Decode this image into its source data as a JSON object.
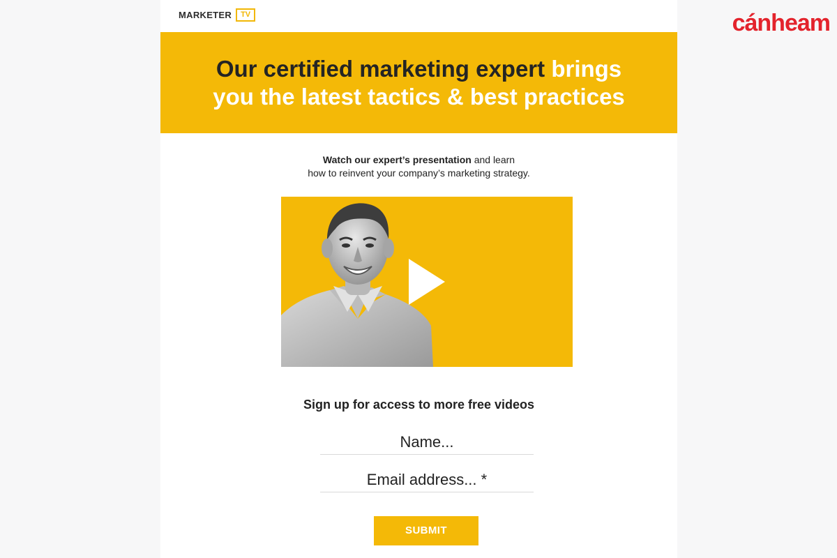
{
  "brand": {
    "name": "cánheam",
    "color": "#e3232c"
  },
  "header": {
    "logo_word": "MARKETER",
    "logo_badge": "TV",
    "accent_color": "#f4b907"
  },
  "hero": {
    "line1_dark": "Our certified marketing expert",
    "line1_light": "brings",
    "line2_light": "you the latest tactics & best practices"
  },
  "intro": {
    "bold": "Watch our expert’s presentation",
    "rest": "and learn",
    "line2": "how to reinvent your company’s marketing strategy."
  },
  "video": {
    "play_icon": "play-icon"
  },
  "signup": {
    "title": "Sign up for access to more free videos",
    "name_placeholder": "Name...",
    "email_placeholder": "Email address... *",
    "submit_label": "SUBMIT"
  }
}
